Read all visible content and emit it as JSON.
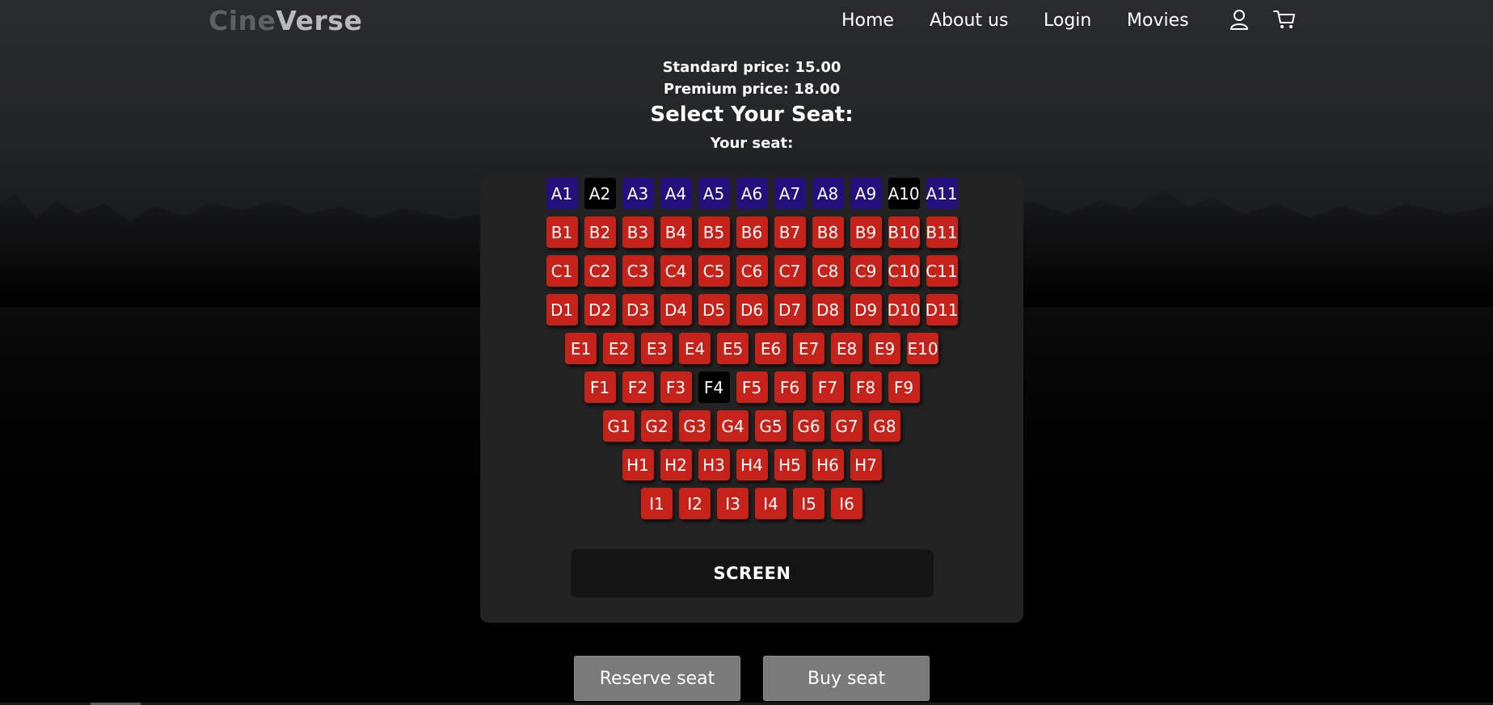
{
  "brand": {
    "part1": "Cine",
    "part2": "Verse"
  },
  "nav": {
    "home": "Home",
    "about": "About us",
    "login": "Login",
    "movies": "Movies",
    "user_icon": "user-icon",
    "cart_icon": "cart-icon"
  },
  "pricing": {
    "standard": "Standard price: 15.00",
    "premium": "Premium price: 18.00"
  },
  "heading": "Select Your Seat:",
  "your_seat": "Your seat:",
  "colors": {
    "standard_seat": "#c5221a",
    "premium_seat": "#24107c",
    "taken_seat": "#000000"
  },
  "rows": [
    {
      "label": "A",
      "seats": [
        {
          "id": "A1",
          "status": "premium"
        },
        {
          "id": "A2",
          "status": "taken"
        },
        {
          "id": "A3",
          "status": "premium"
        },
        {
          "id": "A4",
          "status": "premium"
        },
        {
          "id": "A5",
          "status": "premium"
        },
        {
          "id": "A6",
          "status": "premium"
        },
        {
          "id": "A7",
          "status": "premium"
        },
        {
          "id": "A8",
          "status": "premium"
        },
        {
          "id": "A9",
          "status": "premium"
        },
        {
          "id": "A10",
          "status": "taken"
        },
        {
          "id": "A11",
          "status": "premium"
        }
      ]
    },
    {
      "label": "B",
      "seats": [
        {
          "id": "B1",
          "status": "available"
        },
        {
          "id": "B2",
          "status": "available"
        },
        {
          "id": "B3",
          "status": "available"
        },
        {
          "id": "B4",
          "status": "available"
        },
        {
          "id": "B5",
          "status": "available"
        },
        {
          "id": "B6",
          "status": "available"
        },
        {
          "id": "B7",
          "status": "available"
        },
        {
          "id": "B8",
          "status": "available"
        },
        {
          "id": "B9",
          "status": "available"
        },
        {
          "id": "B10",
          "status": "available"
        },
        {
          "id": "B11",
          "status": "available"
        }
      ]
    },
    {
      "label": "C",
      "seats": [
        {
          "id": "C1",
          "status": "available"
        },
        {
          "id": "C2",
          "status": "available"
        },
        {
          "id": "C3",
          "status": "available"
        },
        {
          "id": "C4",
          "status": "available"
        },
        {
          "id": "C5",
          "status": "available"
        },
        {
          "id": "C6",
          "status": "available"
        },
        {
          "id": "C7",
          "status": "available"
        },
        {
          "id": "C8",
          "status": "available"
        },
        {
          "id": "C9",
          "status": "available"
        },
        {
          "id": "C10",
          "status": "available"
        },
        {
          "id": "C11",
          "status": "available"
        }
      ]
    },
    {
      "label": "D",
      "seats": [
        {
          "id": "D1",
          "status": "available"
        },
        {
          "id": "D2",
          "status": "available"
        },
        {
          "id": "D3",
          "status": "available"
        },
        {
          "id": "D4",
          "status": "available"
        },
        {
          "id": "D5",
          "status": "available"
        },
        {
          "id": "D6",
          "status": "available"
        },
        {
          "id": "D7",
          "status": "available"
        },
        {
          "id": "D8",
          "status": "available"
        },
        {
          "id": "D9",
          "status": "available"
        },
        {
          "id": "D10",
          "status": "available"
        },
        {
          "id": "D11",
          "status": "available"
        }
      ]
    },
    {
      "label": "E",
      "seats": [
        {
          "id": "E1",
          "status": "available"
        },
        {
          "id": "E2",
          "status": "available"
        },
        {
          "id": "E3",
          "status": "available"
        },
        {
          "id": "E4",
          "status": "available"
        },
        {
          "id": "E5",
          "status": "available"
        },
        {
          "id": "E6",
          "status": "available"
        },
        {
          "id": "E7",
          "status": "available"
        },
        {
          "id": "E8",
          "status": "available"
        },
        {
          "id": "E9",
          "status": "available"
        },
        {
          "id": "E10",
          "status": "available"
        }
      ]
    },
    {
      "label": "F",
      "seats": [
        {
          "id": "F1",
          "status": "available"
        },
        {
          "id": "F2",
          "status": "available"
        },
        {
          "id": "F3",
          "status": "available"
        },
        {
          "id": "F4",
          "status": "taken"
        },
        {
          "id": "F5",
          "status": "available"
        },
        {
          "id": "F6",
          "status": "available"
        },
        {
          "id": "F7",
          "status": "available"
        },
        {
          "id": "F8",
          "status": "available"
        },
        {
          "id": "F9",
          "status": "available"
        }
      ]
    },
    {
      "label": "G",
      "seats": [
        {
          "id": "G1",
          "status": "available"
        },
        {
          "id": "G2",
          "status": "available"
        },
        {
          "id": "G3",
          "status": "available"
        },
        {
          "id": "G4",
          "status": "available"
        },
        {
          "id": "G5",
          "status": "available"
        },
        {
          "id": "G6",
          "status": "available"
        },
        {
          "id": "G7",
          "status": "available"
        },
        {
          "id": "G8",
          "status": "available"
        }
      ]
    },
    {
      "label": "H",
      "seats": [
        {
          "id": "H1",
          "status": "available"
        },
        {
          "id": "H2",
          "status": "available"
        },
        {
          "id": "H3",
          "status": "available"
        },
        {
          "id": "H4",
          "status": "available"
        },
        {
          "id": "H5",
          "status": "available"
        },
        {
          "id": "H6",
          "status": "available"
        },
        {
          "id": "H7",
          "status": "available"
        }
      ]
    },
    {
      "label": "I",
      "seats": [
        {
          "id": "I1",
          "status": "available"
        },
        {
          "id": "I2",
          "status": "available"
        },
        {
          "id": "I3",
          "status": "available"
        },
        {
          "id": "I4",
          "status": "available"
        },
        {
          "id": "I5",
          "status": "available"
        },
        {
          "id": "I6",
          "status": "available"
        }
      ]
    }
  ],
  "screen_label": "SCREEN",
  "buttons": {
    "reserve": "Reserve seat",
    "buy": "Buy seat"
  }
}
